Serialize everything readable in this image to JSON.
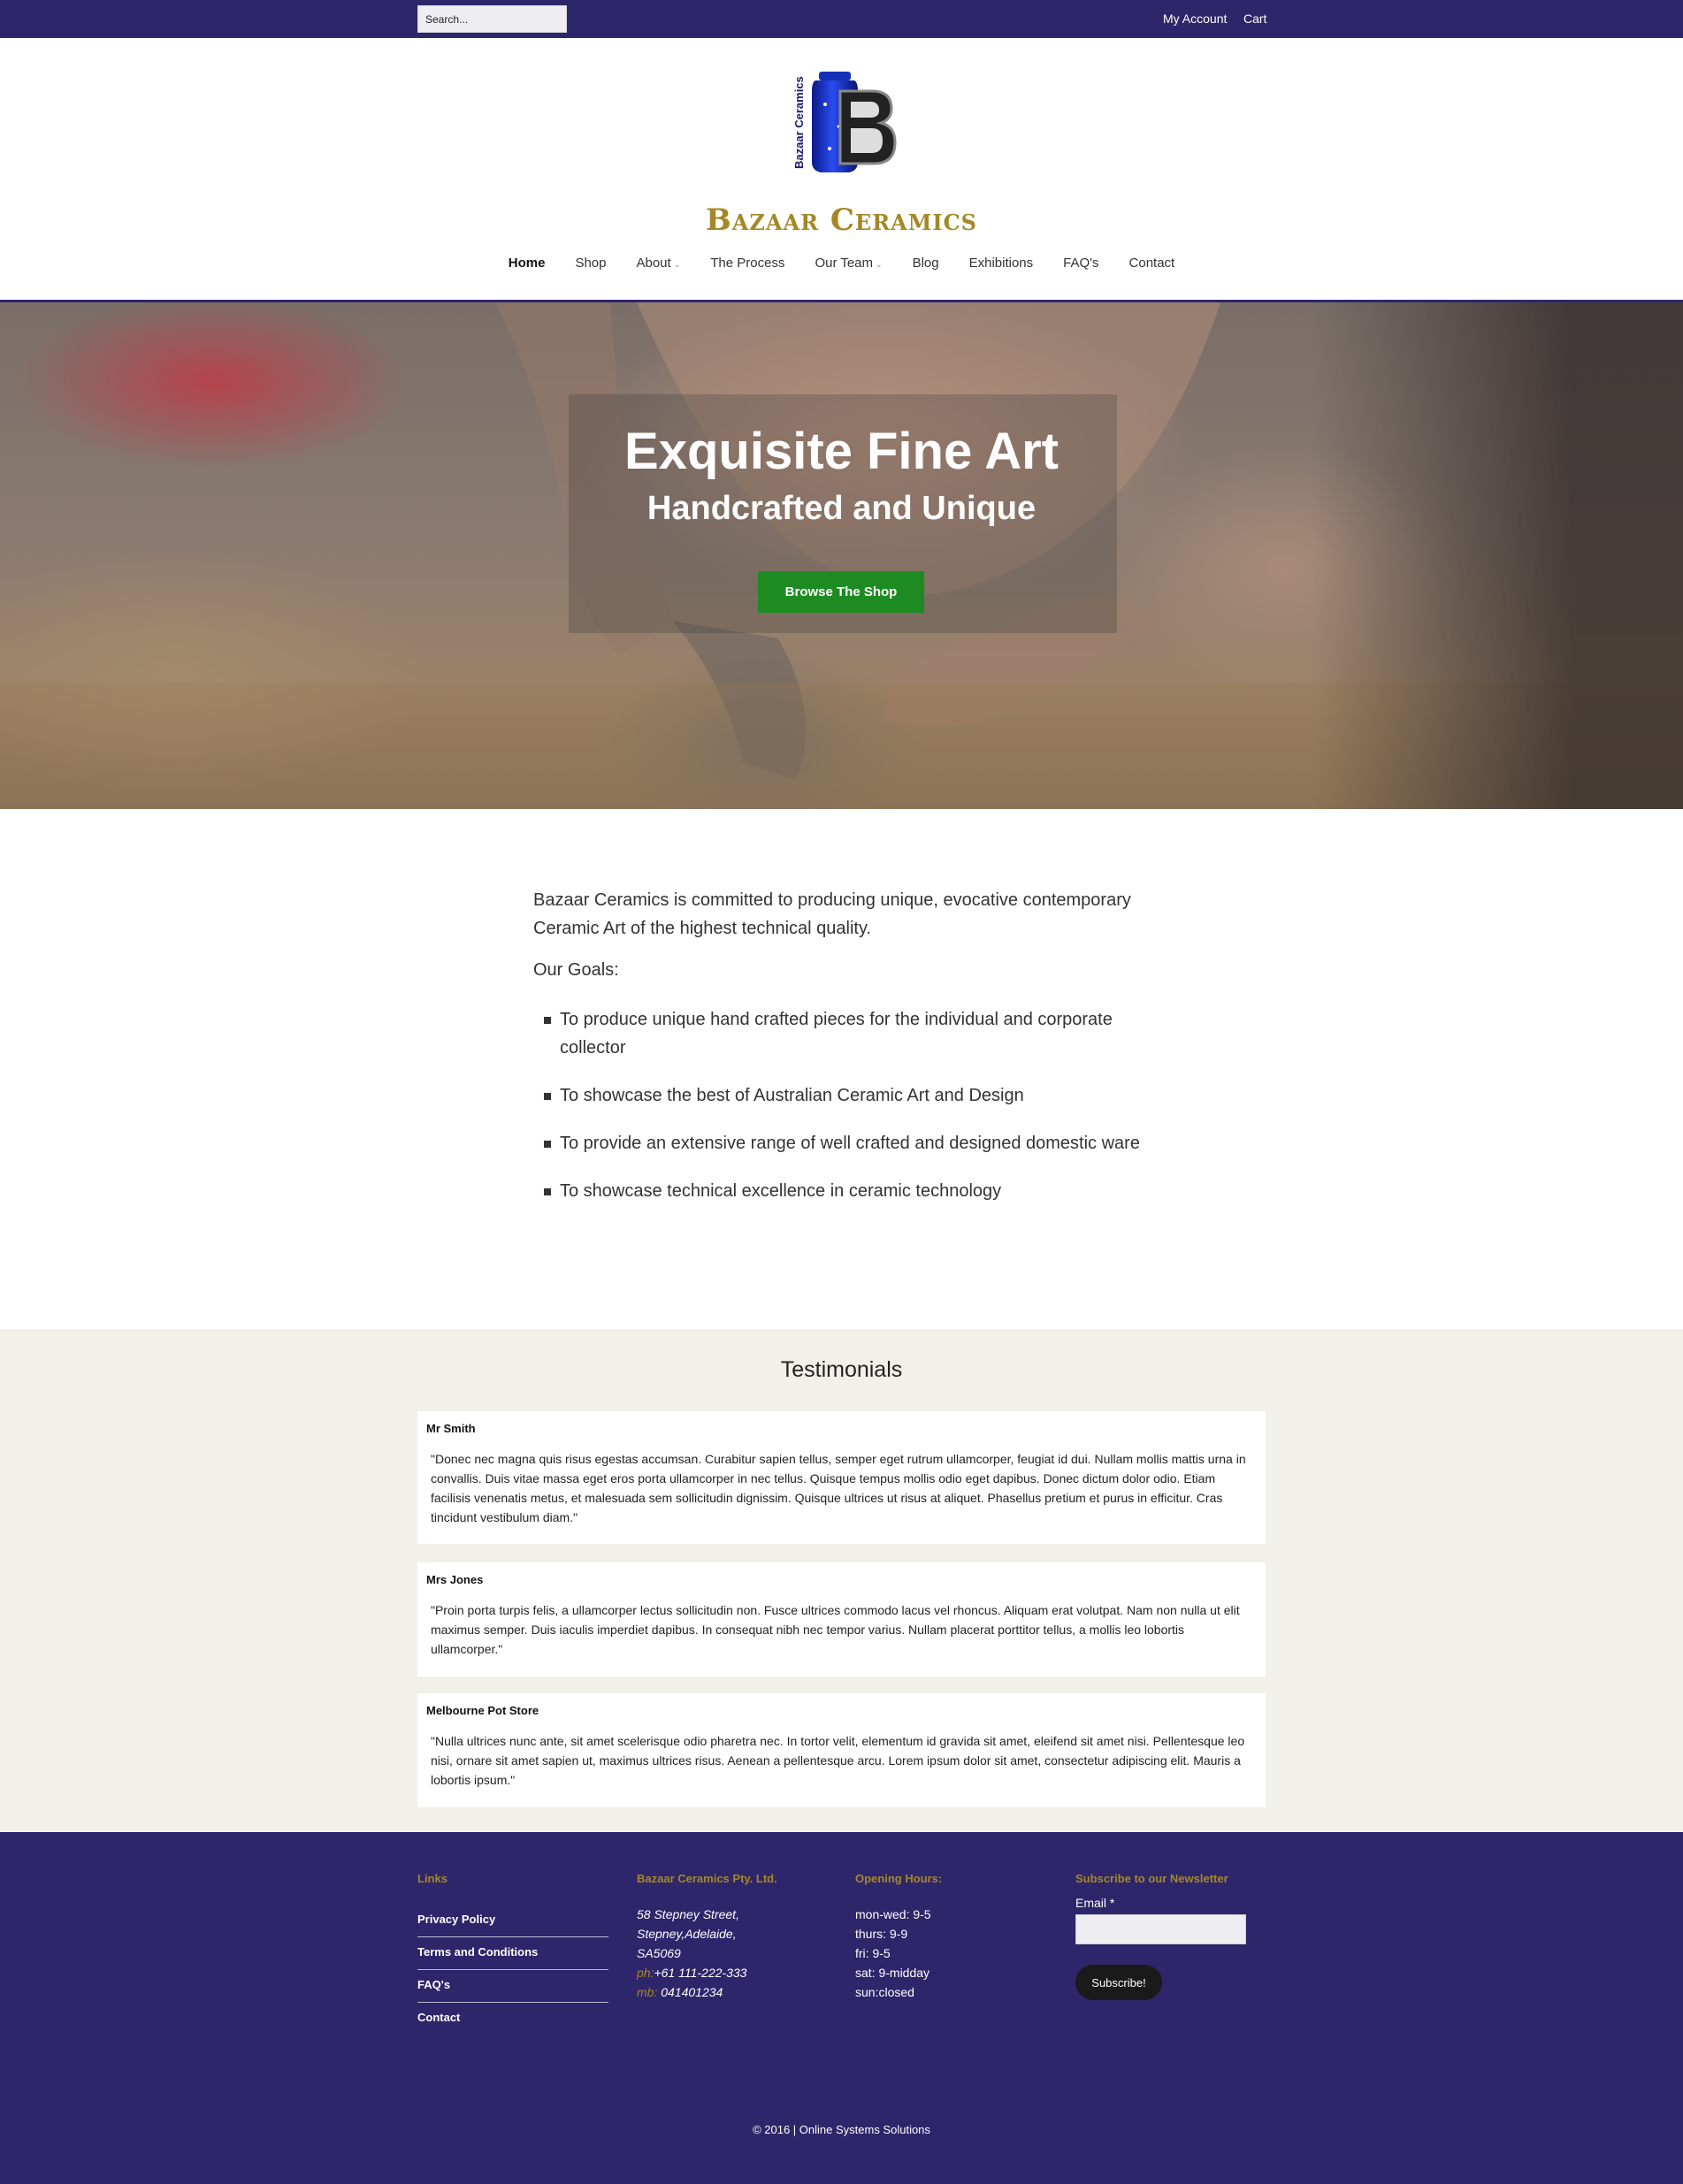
{
  "topbar": {
    "search_placeholder": "Search...",
    "my_account": "My Account",
    "cart": "Cart"
  },
  "header": {
    "logo_vertical_text": "Bazaar Ceramics",
    "logo_text": "Bazaar Ceramics",
    "nav": {
      "home": "Home",
      "shop": "Shop",
      "about": "About",
      "process": "The Process",
      "team": "Our Team",
      "blog": "Blog",
      "exhibitions": "Exhibitions",
      "faqs": "FAQ's",
      "contact": "Contact"
    }
  },
  "hero": {
    "title": "Exquisite Fine Art",
    "subtitle": "Handcrafted and Unique",
    "button": "Browse The Shop"
  },
  "intro": {
    "paragraph": "Bazaar Ceramics is committed to producing unique, evocative contemporary Ceramic Art of the highest technical quality.",
    "goals_title": "Our Goals:",
    "goals": [
      "To produce unique hand crafted pieces for the individual and corporate collector",
      "To showcase the best of Australian Ceramic Art and Design",
      "To provide an extensive range of well crafted and designed domestic ware",
      "To showcase technical excellence in ceramic technology"
    ]
  },
  "testimonials": {
    "title": "Testimonials",
    "items": [
      {
        "name": "Mr Smith",
        "quote": "\"Donec nec magna quis risus egestas accumsan. Curabitur sapien tellus, semper eget rutrum ullamcorper, feugiat id dui. Nullam mollis mattis urna in convallis. Duis vitae massa eget eros porta ullamcorper in nec tellus. Quisque tempus mollis odio eget dapibus. Donec dictum dolor odio. Etiam facilisis venenatis metus, et malesuada sem sollicitudin dignissim. Quisque ultrices ut risus at aliquet. Phasellus pretium et purus in efficitur. Cras tincidunt vestibulum diam.\""
      },
      {
        "name": "Mrs Jones",
        "quote": "\"Proin porta turpis felis, a ullamcorper lectus sollicitudin non. Fusce ultrices commodo lacus vel rhoncus. Aliquam erat volutpat. Nam non nulla ut elit maximus semper. Duis iaculis imperdiet dapibus. In consequat nibh nec tempor varius. Nullam placerat porttitor tellus, a mollis leo lobortis ullamcorper.\""
      },
      {
        "name": "Melbourne Pot Store",
        "quote": "\"Nulla ultrices nunc ante, sit amet scelerisque odio pharetra nec. In tortor velit, elementum id gravida sit amet, eleifend sit amet nisi. Pellentesque leo nisi, ornare sit amet sapien ut, maximus ultrices risus. Aenean a pellentesque arcu. Lorem ipsum dolor sit amet, consectetur adipiscing elit. Mauris a lobortis ipsum.\""
      }
    ]
  },
  "footer": {
    "links_title": "Links",
    "links": [
      "Privacy Policy",
      "Terms and Conditions",
      "FAQ's",
      "Contact"
    ],
    "company_title": "Bazaar Ceramics Pty. Ltd.",
    "address": [
      "58 Stepney Street,",
      "Stepney,Adelaide,",
      "SA5069"
    ],
    "phone_label": "ph:",
    "phone": "+61 111-222-333",
    "mobile_label": "mb:",
    "mobile": " 041401234",
    "hours_title": "Opening Hours:",
    "hours": [
      "mon-wed: 9-5",
      "thurs: 9-9",
      "fri: 9-5",
      "sat: 9-midday",
      "sun:closed"
    ],
    "newsletter_title": "Subscribe to our Newsletter",
    "email_label": "Email",
    "required_mark": "*",
    "subscribe_button": "Subscribe!",
    "copyright": "© 2016 | Online Systems Solutions"
  },
  "colors": {
    "brand_purple": "#2e266a",
    "gold": "#a58726",
    "cta_green": "#1e8a22",
    "testimonial_bg": "#f2f1e9"
  }
}
